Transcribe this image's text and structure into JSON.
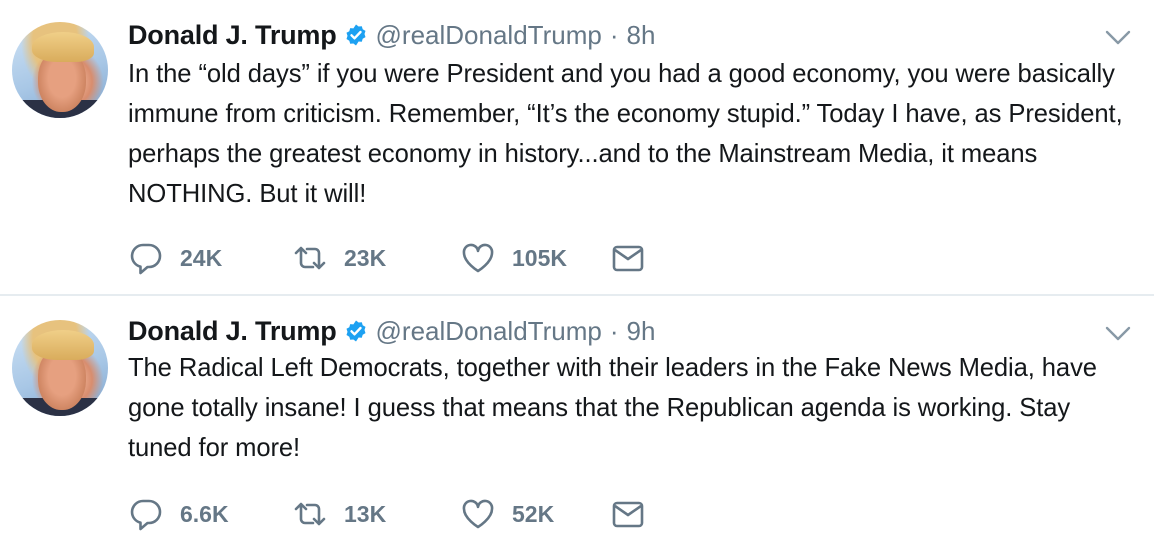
{
  "tweets": [
    {
      "name": "Donald J. Trump",
      "handle": "@realDonaldTrump",
      "separator": "·",
      "time": "8h",
      "text": "In the “old days” if you were President and you had a good economy, you were basically immune from criticism. Remember, “It’s the economy stupid.” Today I have, as President, perhaps the greatest economy in history...and to the Mainstream Media, it means NOTHING. But it will!",
      "replies": "24K",
      "retweets": "23K",
      "likes": "105K"
    },
    {
      "name": "Donald J. Trump",
      "handle": "@realDonaldTrump",
      "separator": "·",
      "time": "9h",
      "text": "The Radical Left Democrats, together with their leaders in the Fake News Media, have gone totally insane! I guess that means that the Republican agenda is working. Stay tuned for more!",
      "replies": "6.6K",
      "retweets": "13K",
      "likes": "52K"
    }
  ],
  "icons": {
    "verified": "verified-badge-icon",
    "menu": "chevron-down-icon",
    "reply": "reply-icon",
    "retweet": "retweet-icon",
    "like": "heart-icon",
    "message": "envelope-icon"
  },
  "colors": {
    "text": "#14171a",
    "muted": "#657786",
    "verified": "#1da1f2",
    "divider": "#e6ecf0"
  }
}
